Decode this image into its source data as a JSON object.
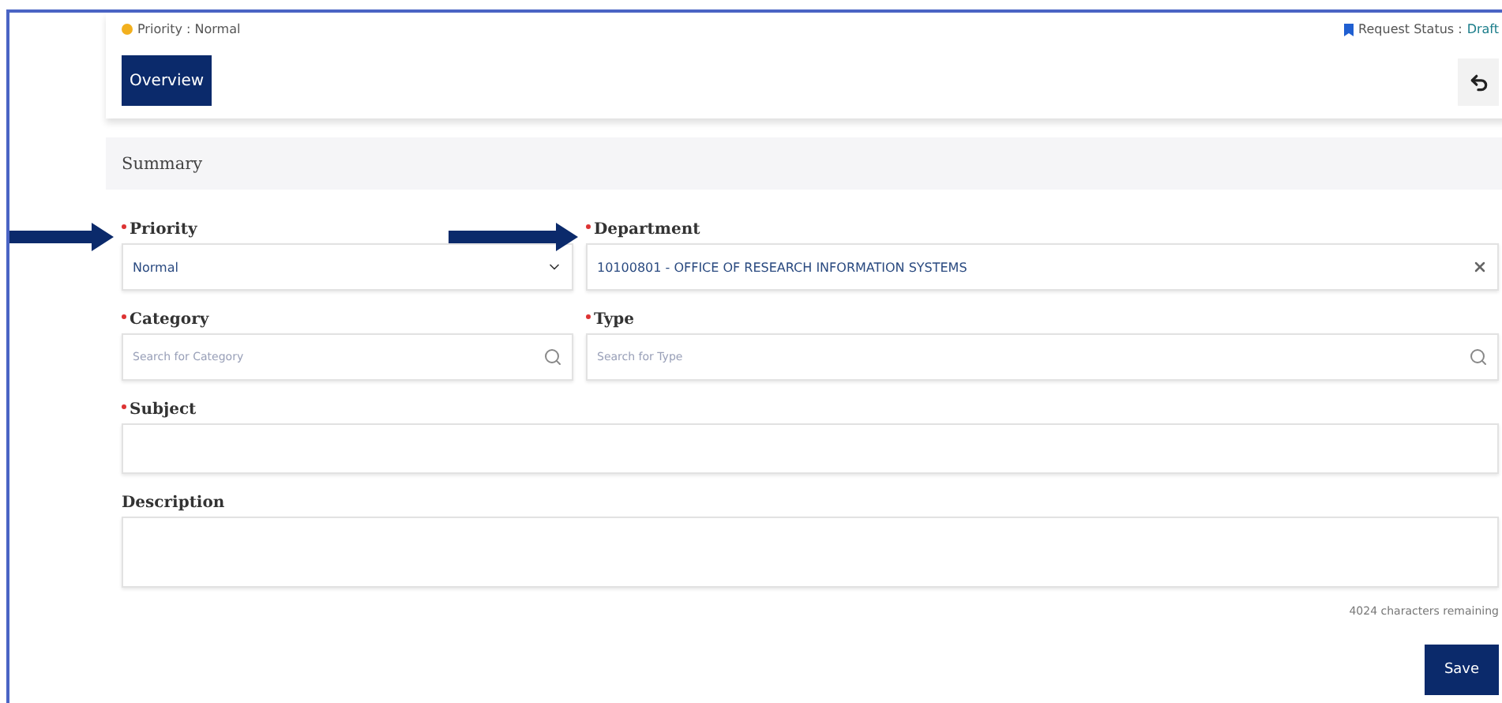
{
  "header": {
    "priority": {
      "label": "Priority : Normal",
      "color": "#f2b01e"
    },
    "request_status": {
      "label": "Request Status :",
      "value": "Draft"
    },
    "tabs": [
      {
        "label": "Overview",
        "selected": true
      }
    ]
  },
  "section": {
    "title": "Summary"
  },
  "fields": [
    {
      "label": "Priority",
      "required": true,
      "kind": "select",
      "value": "Normal",
      "arrow": true
    },
    {
      "label": "Department",
      "required": true,
      "kind": "lookup",
      "value": "10100801 - OFFICE OF RESEARCH INFORMATION SYSTEMS",
      "arrow": true
    },
    {
      "label": "Category",
      "required": true,
      "kind": "search",
      "placeholder": "Search for Category",
      "arrow": false
    },
    {
      "label": "Type",
      "required": true,
      "kind": "search",
      "placeholder": "Search for Type",
      "arrow": false
    },
    {
      "label": "Subject",
      "required": true,
      "kind": "text",
      "arrow": false
    },
    {
      "label": "Description",
      "required": false,
      "kind": "textarea",
      "arrow": false
    }
  ],
  "remaining": "4024 characters remaining",
  "buttons": [
    "Save"
  ]
}
